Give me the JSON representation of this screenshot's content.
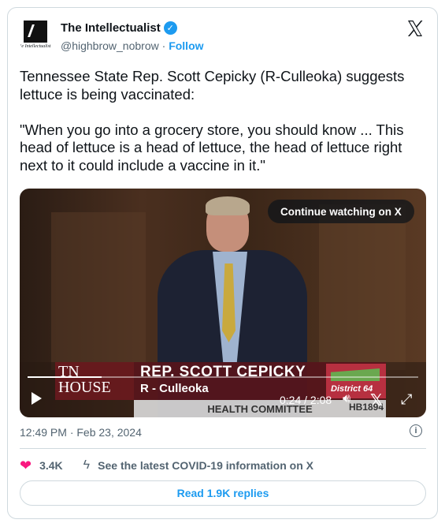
{
  "author": {
    "name": "The Intellectualist",
    "handle": "@highbrow_nobrow",
    "separator": "·",
    "follow_label": "Follow",
    "avatar_text": "‘e Intellectualist"
  },
  "tweet": {
    "text": "Tennessee State Rep. Scott Cepicky (R-Culleoka) suggests lettuce is being vaccinated:\n\n\"When you go into a grocery store, you should know ... This head of lettuce is a head of lettuce, the head of lettuce right next to it could include a vaccine in it.\""
  },
  "video": {
    "continue_label": "Continue watching on X",
    "lower_third": {
      "logo_line1": "TN",
      "logo_line2": "HOUSE",
      "name": "REP. SCOTT CEPICKY",
      "party": "R - Culleoka",
      "district": "District 64",
      "committee": "HEALTH COMMITTEE",
      "bill": "HB1894"
    },
    "time_display": "0:24 / 2:08",
    "progress": 0.19
  },
  "meta": {
    "timestamp": "12:49 PM · Feb 23, 2024"
  },
  "actions": {
    "likes": "3.4K",
    "covid_info": "See the latest COVID-19 information on X"
  },
  "replies_button": "Read 1.9K replies",
  "colors": {
    "accent": "#1d9bf0",
    "like": "#f91880",
    "border": "#cfd9de",
    "secondary_text": "#536471"
  }
}
